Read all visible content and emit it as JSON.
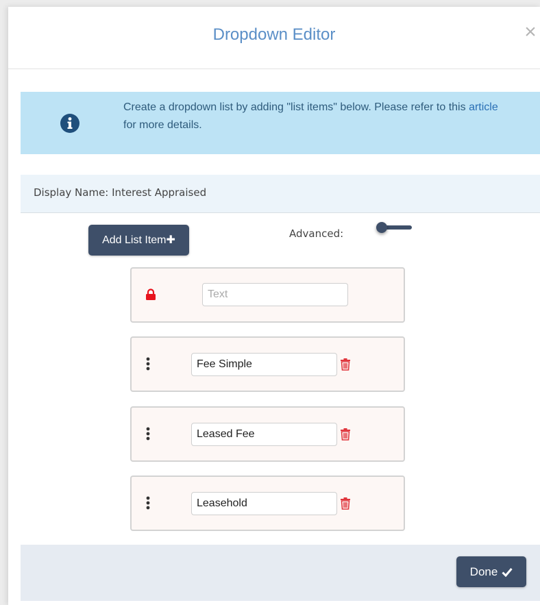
{
  "dialog": {
    "title": "Dropdown Editor",
    "close_glyph": "×"
  },
  "info": {
    "icon": "info-circle-icon",
    "text_before": "Create a dropdown list by adding \"list items\" below. Please refer to this ",
    "link_text": "article",
    "text_after": " for more details."
  },
  "display_name": {
    "label": "Display Name: Interest Appraised"
  },
  "toolbar": {
    "add_label": "Add List Item",
    "add_icon_glyph": "✚",
    "advanced_label": "Advanced:",
    "advanced_on": false
  },
  "items": [
    {
      "locked": true,
      "value": "",
      "placeholder": "Text"
    },
    {
      "locked": false,
      "value": "Fee Simple"
    },
    {
      "locked": false,
      "value": "Leased Fee"
    },
    {
      "locked": false,
      "value": "Leasehold"
    }
  ],
  "footer": {
    "done_label": "Done"
  },
  "colors": {
    "title": "#5b8fc7",
    "info_background": "#bde3f5",
    "button": "#3e4f69",
    "delete": "#e0353c",
    "lock": "#e8141e"
  }
}
